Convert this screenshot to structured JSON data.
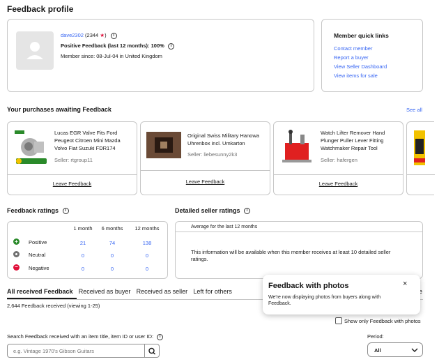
{
  "page_title": "Feedback profile",
  "profile": {
    "username": "dave2302",
    "score": "(2344",
    "score_close": ")",
    "star": "★",
    "positive_feedback": "Positive Feedback (last 12 months): 100%",
    "member_since": "Member since: 08-Jul-04 in United Kingdom"
  },
  "quick_links": {
    "title": "Member quick links",
    "links": [
      "Contact member",
      "Report a buyer",
      "View Seller Dashboard",
      "View items for sale"
    ]
  },
  "purchases": {
    "title": "Your purchases awaiting Feedback",
    "see_all": "See all",
    "items": [
      {
        "title": "Lucas EGR Valve Fits Ford Peugeot Citroen Mini Mazda Volvo Fiat Suzuki FDR174",
        "seller": "Seller: rtgroup11",
        "action": "Leave Feedback"
      },
      {
        "title": "Original Swiss Military Hanowa Uhrenbox incl. Umkarton",
        "seller": "Seller: liebesunny2k3",
        "action": "Leave Feedback"
      },
      {
        "title": "Watch Lifter Remover Hand Plunger Puller Lever Fitting Watchmaker Repair Tool",
        "seller": "Seller: hafergen",
        "action": "Leave Feedback"
      }
    ]
  },
  "ratings": {
    "title": "Feedback ratings",
    "columns": [
      "1 month",
      "6 months",
      "12 months"
    ],
    "rows": [
      {
        "label": "Positive",
        "values": [
          "21",
          "74",
          "138"
        ]
      },
      {
        "label": "Neutral",
        "values": [
          "0",
          "0",
          "0"
        ]
      },
      {
        "label": "Negative",
        "values": [
          "0",
          "0",
          "0"
        ]
      }
    ]
  },
  "detailed": {
    "title": "Detailed seller ratings",
    "subtitle": "Average for the last 12 months",
    "message": "This information will be available when this member receives at least 10 detailed seller ratings."
  },
  "tabs": [
    "All received Feedback",
    "Received as buyer",
    "Received as seller",
    "Left for others"
  ],
  "tab_overflow": "ne",
  "feedback_count": "2,644 Feedback received (viewing 1-25)",
  "popover": {
    "title": "Feedback with photos",
    "body": "We're now displaying photos from buyers along with Feedback.",
    "close": "×"
  },
  "photos_checkbox": "Show only Feedback with photos",
  "search": {
    "label": "Search Feedback received with an item title, item ID or user ID:",
    "placeholder": "e.g. Vintage 1970's Gibson Guitars"
  },
  "period": {
    "label": "Period:",
    "value": "All"
  },
  "colors": {
    "link": "#3665f3",
    "positive": "#2a8a2a",
    "negative": "#e0103a",
    "neutral": "#707070"
  }
}
